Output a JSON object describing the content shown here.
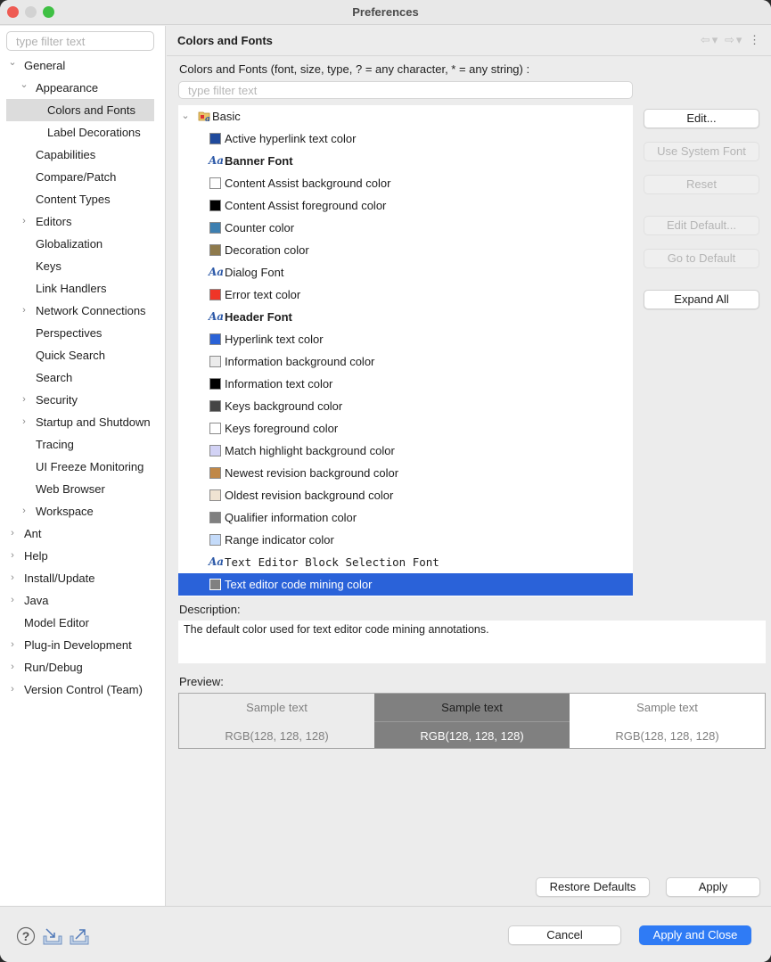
{
  "window": {
    "title": "Preferences"
  },
  "sidebar": {
    "filter_placeholder": "type filter text",
    "items": [
      {
        "label": "General",
        "level": 0,
        "chevron": "expanded"
      },
      {
        "label": "Appearance",
        "level": 1,
        "chevron": "expanded"
      },
      {
        "label": "Colors and Fonts",
        "level": 2,
        "chevron": "none",
        "selected": true
      },
      {
        "label": "Label Decorations",
        "level": 2,
        "chevron": "none"
      },
      {
        "label": "Capabilities",
        "level": 1,
        "chevron": "none"
      },
      {
        "label": "Compare/Patch",
        "level": 1,
        "chevron": "none"
      },
      {
        "label": "Content Types",
        "level": 1,
        "chevron": "none"
      },
      {
        "label": "Editors",
        "level": 1,
        "chevron": "collapsed"
      },
      {
        "label": "Globalization",
        "level": 1,
        "chevron": "none"
      },
      {
        "label": "Keys",
        "level": 1,
        "chevron": "none"
      },
      {
        "label": "Link Handlers",
        "level": 1,
        "chevron": "none"
      },
      {
        "label": "Network Connections",
        "level": 1,
        "chevron": "collapsed"
      },
      {
        "label": "Perspectives",
        "level": 1,
        "chevron": "none"
      },
      {
        "label": "Quick Search",
        "level": 1,
        "chevron": "none"
      },
      {
        "label": "Search",
        "level": 1,
        "chevron": "none"
      },
      {
        "label": "Security",
        "level": 1,
        "chevron": "collapsed"
      },
      {
        "label": "Startup and Shutdown",
        "level": 1,
        "chevron": "collapsed"
      },
      {
        "label": "Tracing",
        "level": 1,
        "chevron": "none"
      },
      {
        "label": "UI Freeze Monitoring",
        "level": 1,
        "chevron": "none"
      },
      {
        "label": "Web Browser",
        "level": 1,
        "chevron": "none"
      },
      {
        "label": "Workspace",
        "level": 1,
        "chevron": "collapsed"
      },
      {
        "label": "Ant",
        "level": 0,
        "chevron": "collapsed"
      },
      {
        "label": "Help",
        "level": 0,
        "chevron": "collapsed"
      },
      {
        "label": "Install/Update",
        "level": 0,
        "chevron": "collapsed"
      },
      {
        "label": "Java",
        "level": 0,
        "chevron": "collapsed"
      },
      {
        "label": "Model Editor",
        "level": 0,
        "chevron": "none"
      },
      {
        "label": "Plug-in Development",
        "level": 0,
        "chevron": "collapsed"
      },
      {
        "label": "Run/Debug",
        "level": 0,
        "chevron": "collapsed"
      },
      {
        "label": "Version Control (Team)",
        "level": 0,
        "chevron": "collapsed"
      }
    ]
  },
  "page": {
    "title": "Colors and Fonts",
    "filter_description": "Colors and Fonts (font, size, type, ? = any character, * = any string) :",
    "filter_placeholder": "type filter text",
    "category": "Basic",
    "entries": [
      {
        "label": "Active hyperlink text color",
        "type": "color",
        "color": "#1f4a9c"
      },
      {
        "label": "Banner Font",
        "type": "font",
        "style": "bold"
      },
      {
        "label": "Content Assist background color",
        "type": "color",
        "color": "#ffffff"
      },
      {
        "label": "Content Assist foreground color",
        "type": "color",
        "color": "#000000"
      },
      {
        "label": "Counter color",
        "type": "color",
        "color": "#3d7fb0"
      },
      {
        "label": "Decoration color",
        "type": "color",
        "color": "#8e7a4c"
      },
      {
        "label": "Dialog Font",
        "type": "font",
        "style": "normal"
      },
      {
        "label": "Error text color",
        "type": "color",
        "color": "#ef3527"
      },
      {
        "label": "Header Font",
        "type": "font",
        "style": "bold"
      },
      {
        "label": "Hyperlink text color",
        "type": "color",
        "color": "#2a62d6"
      },
      {
        "label": "Information background color",
        "type": "color",
        "color": "#ebebeb"
      },
      {
        "label": "Information text color",
        "type": "color",
        "color": "#000000"
      },
      {
        "label": "Keys background color",
        "type": "color",
        "color": "#454545"
      },
      {
        "label": "Keys foreground color",
        "type": "color",
        "color": "#ffffff"
      },
      {
        "label": "Match highlight background color",
        "type": "color",
        "color": "#d2d2f5"
      },
      {
        "label": "Newest revision background color",
        "type": "color",
        "color": "#c08848"
      },
      {
        "label": "Oldest revision background color",
        "type": "color",
        "color": "#efe3d2"
      },
      {
        "label": "Qualifier information color",
        "type": "color",
        "color": "#808080"
      },
      {
        "label": "Range indicator color",
        "type": "color",
        "color": "#c4dbfa"
      },
      {
        "label": "Text Editor Block Selection Font",
        "type": "font",
        "style": "mono"
      },
      {
        "label": "Text editor code mining color",
        "type": "color",
        "color": "#808080",
        "selected": true
      }
    ],
    "buttons": {
      "edit": "Edit...",
      "use_system_font": "Use System Font",
      "reset": "Reset",
      "edit_default": "Edit Default...",
      "go_to_default": "Go to Default",
      "expand_all": "Expand All"
    },
    "description_label": "Description:",
    "description": "The default color used for text editor code mining annotations.",
    "preview_label": "Preview:",
    "preview": [
      {
        "sample": "Sample text",
        "rgb": "RGB(128, 128, 128)",
        "bg": "#ececec"
      },
      {
        "sample": "Sample text",
        "rgb": "RGB(128, 128, 128)",
        "bg": "#808080"
      },
      {
        "sample": "Sample text",
        "rgb": "RGB(128, 128, 128)",
        "bg": "#ffffff"
      }
    ],
    "restore_defaults": "Restore Defaults",
    "apply": "Apply"
  },
  "footer": {
    "cancel": "Cancel",
    "apply_and_close": "Apply and Close"
  },
  "colors": {
    "accent": "#2f7bf5",
    "selection": "#2a62d9"
  }
}
